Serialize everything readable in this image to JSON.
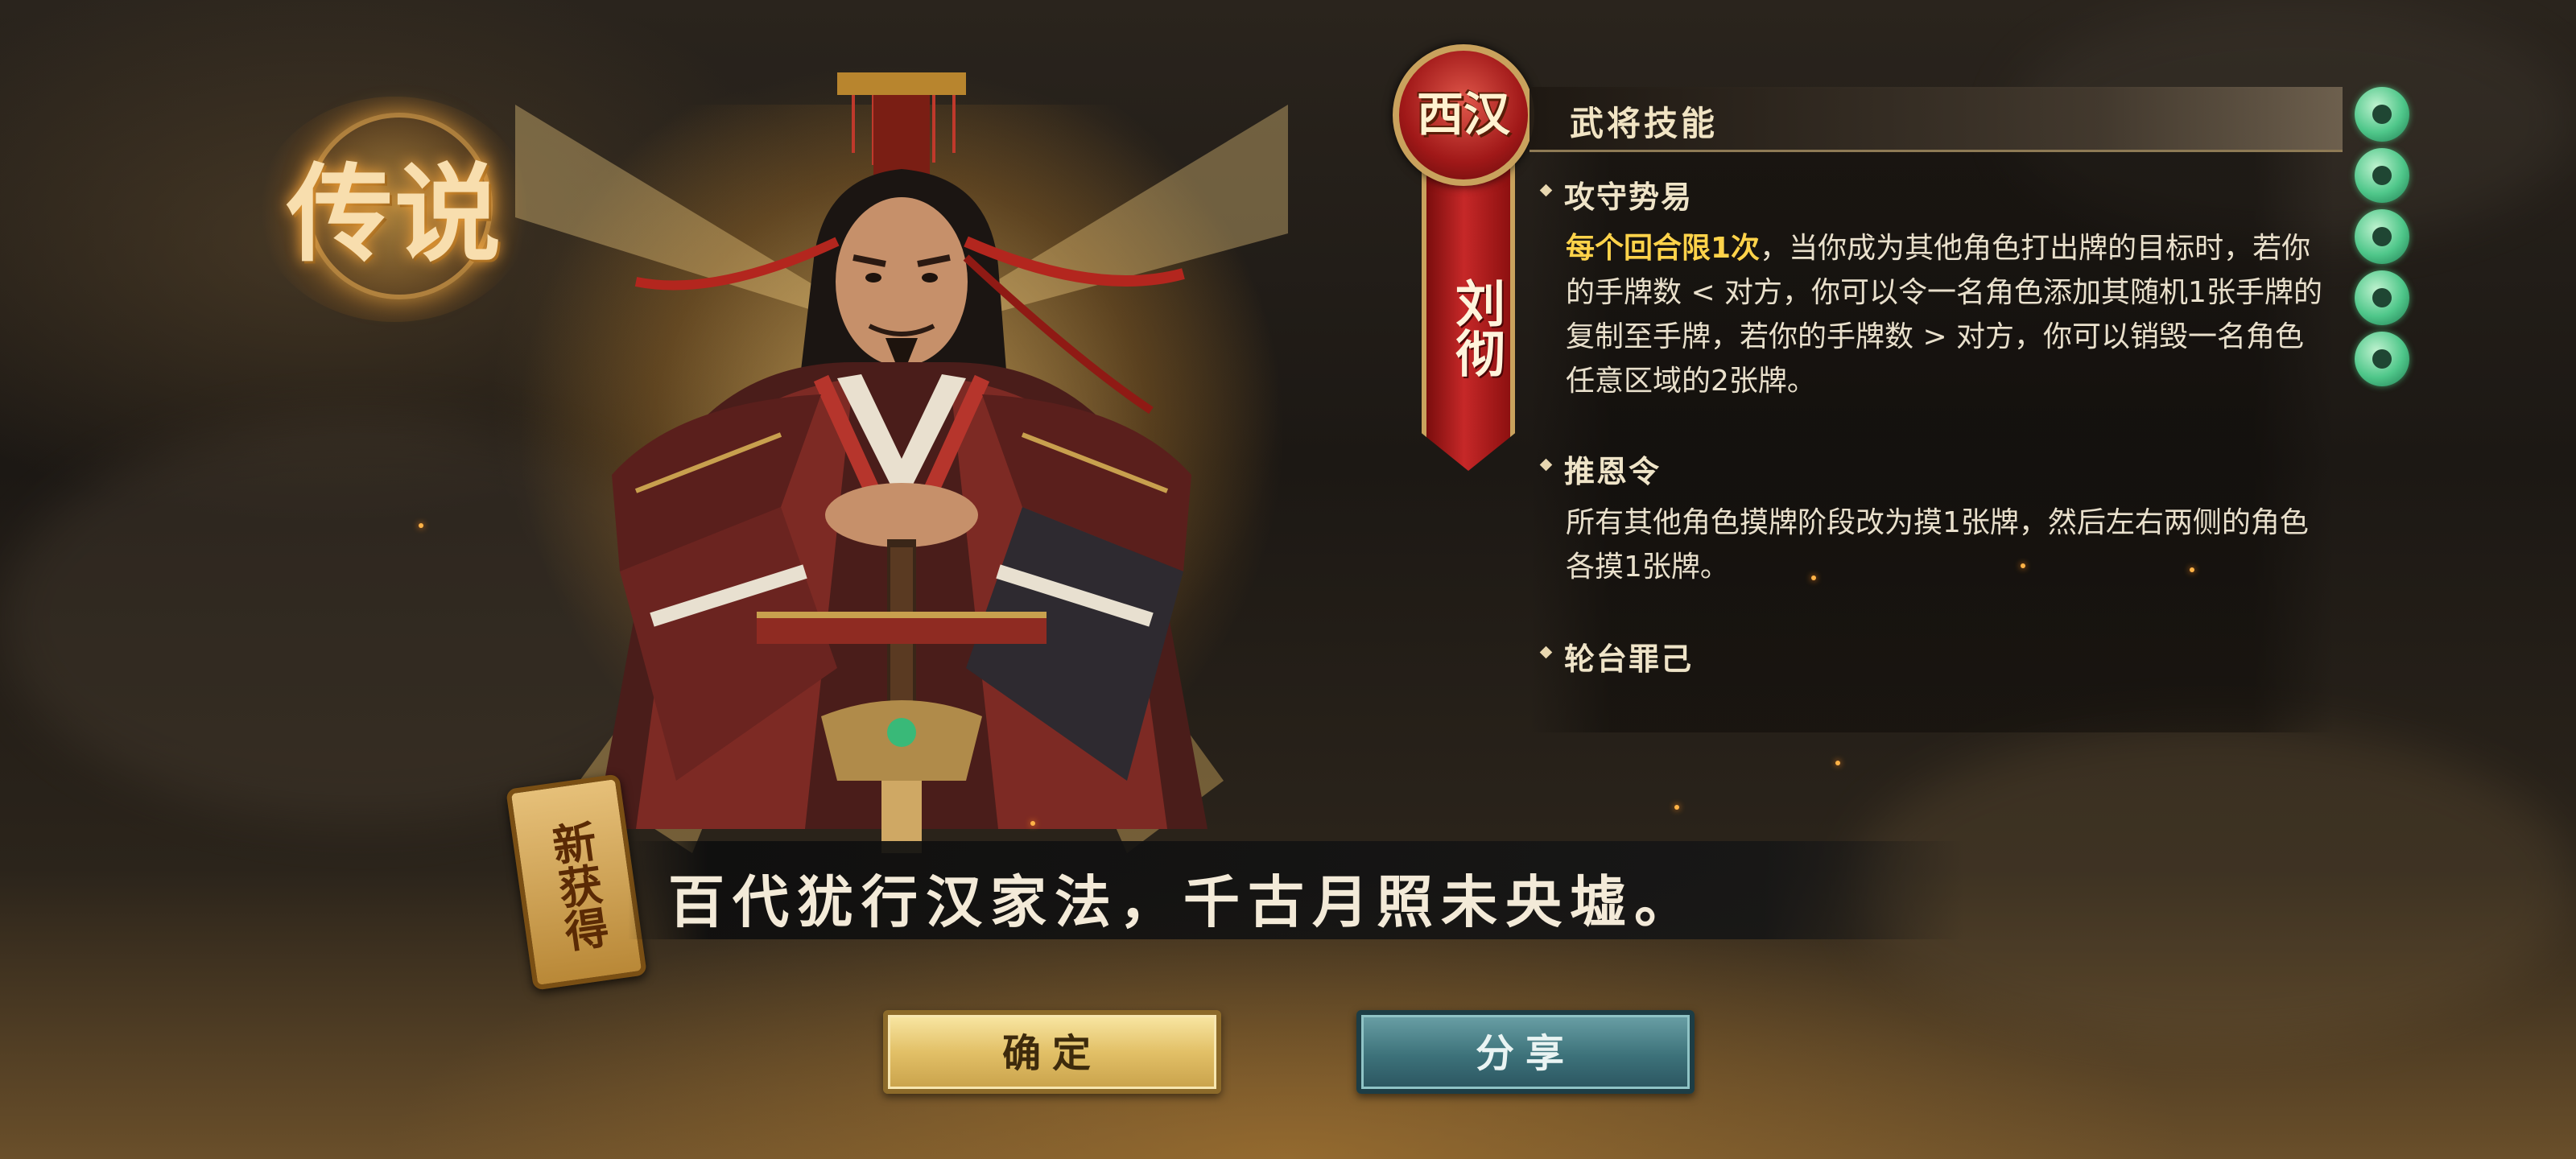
{
  "rarity": {
    "label": "传说"
  },
  "hero": {
    "faction": "西汉",
    "name": "刘彻"
  },
  "skills_panel": {
    "title": "武将技能",
    "skills": [
      {
        "name": "攻守势易",
        "highlight": "每个回合限1次",
        "desc": "，当你成为其他角色打出牌的目标时，若你的手牌数 < 对方，你可以令一名角色添加其随机1张手牌的复制至手牌，若你的手牌数 > 对方，你可以销毁一名角色任意区域的2张牌。"
      },
      {
        "name": "推恩令",
        "highlight": "",
        "desc": "所有其他角色摸牌阶段改为摸1张牌，然后左右两侧的角色各摸1张牌。"
      },
      {
        "name": "轮台罪己",
        "highlight": "",
        "desc": ""
      }
    ]
  },
  "jade_tokens": {
    "count": 5,
    "icon": "jade-token-icon",
    "color": "#4fc78a"
  },
  "badge": {
    "label": "新获得"
  },
  "quote": {
    "text": "百代犹行汉家法，千古月照未央墟。"
  },
  "buttons": {
    "confirm": "确定",
    "share": "分享"
  },
  "colors": {
    "highlight": "#ffd34a",
    "faction_red": "#a01818",
    "confirm_gold": "#e2c067",
    "share_teal": "#3d727a"
  }
}
